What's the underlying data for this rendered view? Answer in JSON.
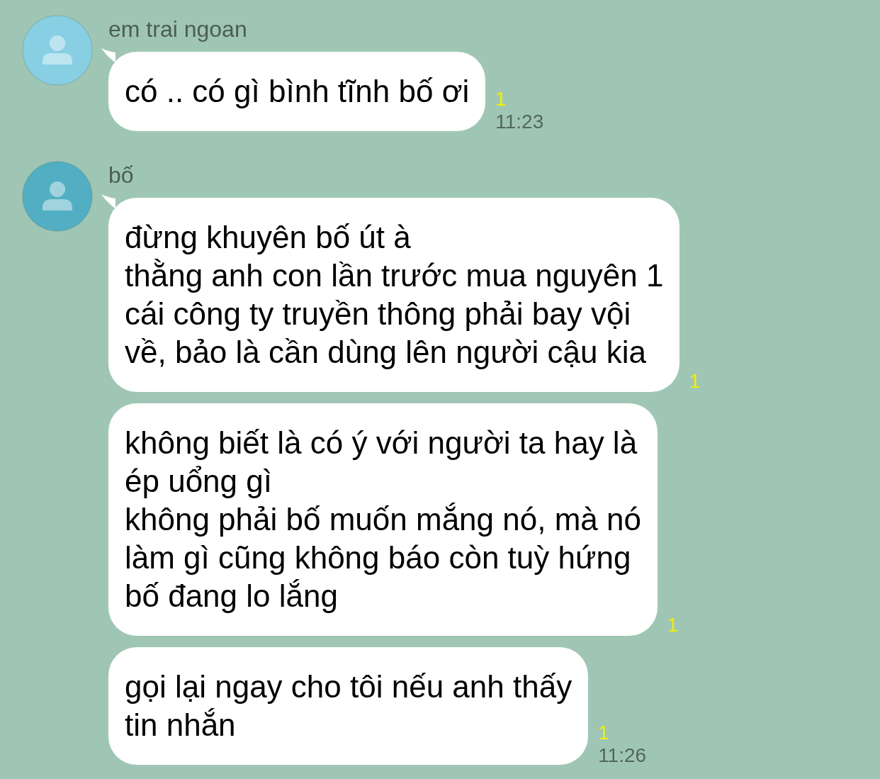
{
  "groups": [
    {
      "sender": "em trai ngoan",
      "color": "#88cfe4",
      "messages": [
        {
          "text": "có .. có gì bình tĩnh bố ơi",
          "read_count": "1",
          "time": "11:23"
        }
      ]
    },
    {
      "sender": "bố",
      "color": "#52afc3",
      "messages": [
        {
          "text": "đừng khuyên bố út à\nthằng anh con lần trước mua nguyên 1\ncái công ty truyền thông phải bay vội\nvề, bảo là cần dùng lên người cậu kia",
          "read_count": "1"
        },
        {
          "text": "không biết là có ý với người ta hay là\nép uổng gì\nkhông phải bố muốn mắng nó, mà nó\nlàm gì cũng không báo còn tuỳ hứng\nbố đang lo lắng",
          "read_count": "1"
        },
        {
          "text": "gọi lại ngay cho tôi nếu anh thấy\ntin nhắn",
          "read_count": "1",
          "time": "11:26"
        }
      ]
    }
  ]
}
